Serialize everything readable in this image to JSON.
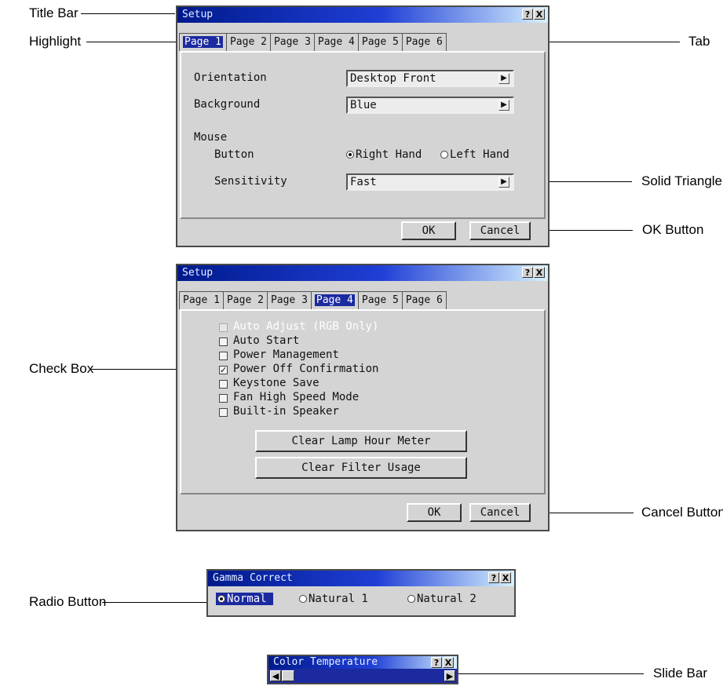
{
  "callouts": {
    "title_bar": "Title Bar",
    "highlight": "Highlight",
    "tab": "Tab",
    "solid_triangle": "Solid Triangle",
    "ok_button": "OK Button",
    "check_box": "Check Box",
    "cancel_button": "Cancel Button",
    "radio_button": "Radio Button",
    "slide_bar": "Slide Bar"
  },
  "titlebar_icons": {
    "help": "?",
    "close": "X"
  },
  "setup1": {
    "title": "Setup",
    "tabs": [
      "Page 1",
      "Page 2",
      "Page 3",
      "Page 4",
      "Page 5",
      "Page 6"
    ],
    "orientation_label": "Orientation",
    "orientation_value": "Desktop Front",
    "background_label": "Background",
    "background_value": "Blue",
    "mouse_label": "Mouse",
    "button_label": "Button",
    "right_hand": "Right Hand",
    "left_hand": "Left Hand",
    "sensitivity_label": "Sensitivity",
    "sensitivity_value": "Fast",
    "ok": "OK",
    "cancel": "Cancel"
  },
  "setup2": {
    "title": "Setup",
    "tabs": [
      "Page 1",
      "Page 2",
      "Page 3",
      "Page 4",
      "Page 5",
      "Page 6"
    ],
    "checkboxes": [
      {
        "label": "Auto Adjust (RGB Only)",
        "checked": false,
        "disabled": true
      },
      {
        "label": "Auto Start",
        "checked": false,
        "disabled": false
      },
      {
        "label": "Power Management",
        "checked": false,
        "disabled": false
      },
      {
        "label": "Power Off Confirmation",
        "checked": true,
        "disabled": false
      },
      {
        "label": "Keystone Save",
        "checked": false,
        "disabled": false
      },
      {
        "label": "Fan High Speed Mode",
        "checked": false,
        "disabled": false
      },
      {
        "label": "Built-in Speaker",
        "checked": false,
        "disabled": false
      }
    ],
    "clear_lamp": "Clear Lamp Hour Meter",
    "clear_filter": "Clear Filter Usage",
    "ok": "OK",
    "cancel": "Cancel"
  },
  "gamma": {
    "title": "Gamma Correct",
    "options": [
      "Normal",
      "Natural 1",
      "Natural 2"
    ],
    "selected": "Normal"
  },
  "color_temp": {
    "title": "Color Temperature",
    "left_arrow": "◀",
    "right_arrow": "▶"
  }
}
